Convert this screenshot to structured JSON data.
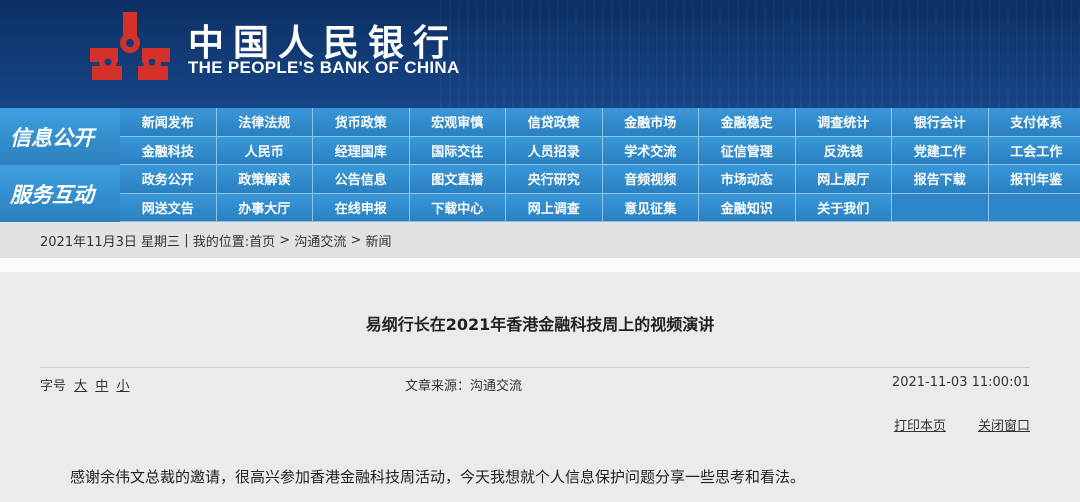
{
  "header": {
    "bank_name_cn": "中国人民银行",
    "bank_name_en": "THE PEOPLE'S BANK OF CHINA",
    "logo_icon": "pboc-emblem-icon",
    "brand_red": "#d3312a",
    "brand_blue": "#123c78"
  },
  "nav": {
    "section1_label": "信息公开",
    "section2_label": "服务互动",
    "rows": [
      [
        "新闻发布",
        "法律法规",
        "货币政策",
        "宏观审慎",
        "信贷政策",
        "金融市场",
        "金融稳定",
        "调查统计",
        "银行会计",
        "支付体系"
      ],
      [
        "金融科技",
        "人民币",
        "经理国库",
        "国际交往",
        "人员招录",
        "学术交流",
        "征信管理",
        "反洗钱",
        "党建工作",
        "工会工作"
      ],
      [
        "政务公开",
        "政策解读",
        "公告信息",
        "图文直播",
        "央行研究",
        "音频视频",
        "市场动态",
        "网上展厅",
        "报告下载",
        "报刊年鉴"
      ],
      [
        "网送文告",
        "办事大厅",
        "在线申报",
        "下载中心",
        "网上调查",
        "意见征集",
        "金融知识",
        "关于我们",
        "",
        ""
      ]
    ]
  },
  "breadcrumb": {
    "date": "2021年11月3日",
    "weekday": "星期三",
    "divider": "|",
    "location_prefix": "我的位置:",
    "home": "首页",
    "arrow1": ">",
    "level1": "沟通交流",
    "arrow2": ">",
    "level2": "新闻"
  },
  "article": {
    "title": "易纲行长在2021年香港金融科技周上的视频演讲",
    "font_size_label": "字号",
    "size_large": "大",
    "size_medium": "中",
    "size_small": "小",
    "source": "文章来源：沟通交流",
    "datetime": "2021-11-03 11:00:01",
    "print_label": "打印本页",
    "close_label": "关闭窗口",
    "first_paragraph": "感谢余伟文总裁的邀请，很高兴参加香港金融科技周活动，今天我想就个人信息保护问题分享一些思考和看法。"
  }
}
